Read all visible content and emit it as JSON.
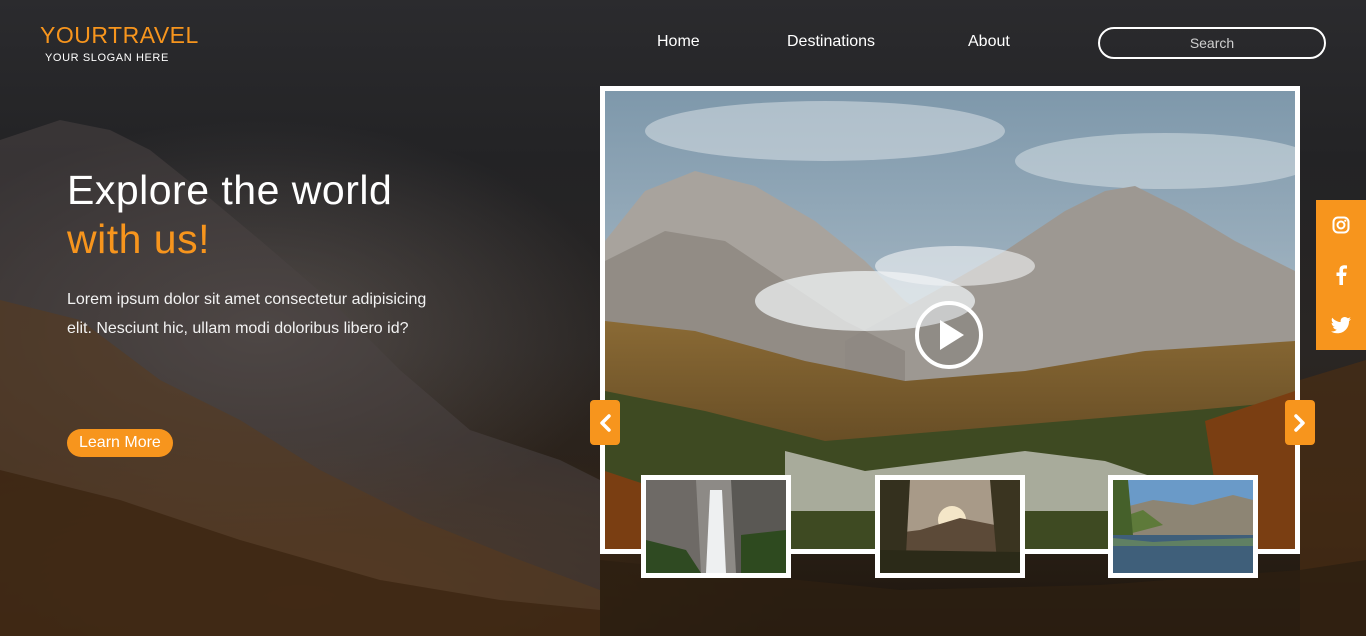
{
  "header": {
    "logo_title": "YOURTRAVEL",
    "logo_slogan": "YOUR SLOGAN HERE",
    "nav": [
      "Home",
      "Destinations",
      "About"
    ],
    "search_placeholder": "Search"
  },
  "hero": {
    "title_line1": "Explore the world",
    "title_line2": "with us!",
    "description": "Lorem ipsum dolor sit amet consectetur adipisicing elit. Nesciunt hic, ullam modi doloribus libero id?",
    "cta_label": "Learn More"
  },
  "slider": {
    "main_image": "mountain-valley-autumn",
    "play_icon": "play-icon",
    "prev_icon": "chevron-left-icon",
    "next_icon": "chevron-right-icon",
    "thumbnails": [
      "waterfall",
      "forest-sunset",
      "lake-reflection"
    ]
  },
  "social": [
    "instagram-icon",
    "facebook-icon",
    "twitter-icon"
  ],
  "colors": {
    "accent": "#f7951d",
    "text": "#ffffff",
    "background": "#1f1f21"
  }
}
